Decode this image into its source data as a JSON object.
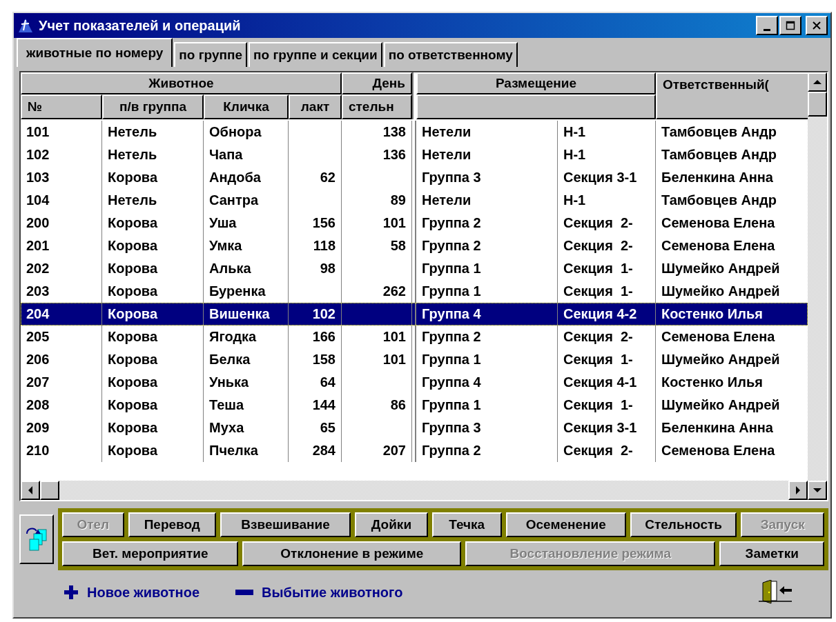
{
  "window": {
    "title": "Учет показателей и операций"
  },
  "tabs": [
    {
      "label": "животные по номеру",
      "selected": true
    },
    {
      "label": "по группе",
      "selected": false
    },
    {
      "label": "по группе и секции",
      "selected": false
    },
    {
      "label": "по ответственному",
      "selected": false
    }
  ],
  "table": {
    "group_headers": {
      "animal": "Животное",
      "day": "День",
      "placement": "Размещение",
      "responsible": "Ответственный("
    },
    "columns": [
      "№",
      "п/в группа",
      "Кличка",
      "лакт",
      "стельн"
    ],
    "rows": [
      {
        "number": "101",
        "group": "Нетель",
        "name": "Обнора",
        "days": "138",
        "placement": "Нетели",
        "section": "Н-1",
        "responsible": "Тамбовцев Андр",
        "selected": false
      },
      {
        "number": "102",
        "group": "Нетель",
        "name": "Чапа",
        "days": "136",
        "placement": "Нетели",
        "section": "Н-1",
        "responsible": "Тамбовцев Андр",
        "selected": false
      },
      {
        "number": "103",
        "group": "Корова",
        "name": "Андоба",
        "lact": "62",
        "placement": "Группа 3",
        "section": "Секция 3-1",
        "responsible": "Беленкина Анна",
        "selected": false
      },
      {
        "number": "104",
        "group": "Нетель",
        "name": "Сантра",
        "days": "89",
        "placement": "Нетели",
        "section": "Н-1",
        "responsible": "Тамбовцев Андр",
        "selected": false
      },
      {
        "number": "200",
        "group": "Корова",
        "name": "Уша",
        "lact": "156",
        "days": "101",
        "placement": "Группа 2",
        "section": "Секция  2-",
        "responsible": "Семенова Елена",
        "selected": false
      },
      {
        "number": "201",
        "group": "Корова",
        "name": "Умка",
        "lact": "118",
        "days": "58",
        "placement": "Группа 2",
        "section": "Секция  2-",
        "responsible": "Семенова Елена",
        "selected": false
      },
      {
        "number": "202",
        "group": "Корова",
        "name": "Алька",
        "lact": "98",
        "placement": "Группа 1",
        "section": "Секция  1-",
        "responsible": "Шумейко Андрей",
        "selected": false
      },
      {
        "number": "203",
        "group": "Корова",
        "name": "Буренка",
        "days": "262",
        "placement": "Группа 1",
        "section": "Секция  1-",
        "responsible": "Шумейко Андрей",
        "selected": false
      },
      {
        "number": "204",
        "group": "Корова",
        "name": "Вишенка",
        "lact": "102",
        "placement": "Группа 4",
        "section": "Секция 4-2",
        "responsible": "Костенко Илья",
        "selected": true
      },
      {
        "number": "205",
        "group": "Корова",
        "name": "Ягодка",
        "lact": "166",
        "days": "101",
        "placement": "Группа 2",
        "section": "Секция  2-",
        "responsible": "Семенова Елена",
        "selected": false
      },
      {
        "number": "206",
        "group": "Корова",
        "name": "Белка",
        "lact": "158",
        "days": "101",
        "placement": "Группа 1",
        "section": "Секция  1-",
        "responsible": "Шумейко Андрей",
        "selected": false
      },
      {
        "number": "207",
        "group": "Корова",
        "name": "Унька",
        "lact": "64",
        "placement": "Группа 4",
        "section": "Секция 4-1",
        "responsible": "Костенко Илья",
        "selected": false
      },
      {
        "number": "208",
        "group": "Корова",
        "name": "Теша",
        "lact": "144",
        "days": "86",
        "placement": "Группа 1",
        "section": "Секция  1-",
        "responsible": "Шумейко Андрей",
        "selected": false
      },
      {
        "number": "209",
        "group": "Корова",
        "name": "Муха",
        "lact": "65",
        "placement": "Группа 3",
        "section": "Секция 3-1",
        "responsible": "Беленкина Анна",
        "selected": false
      },
      {
        "number": "210",
        "group": "Корова",
        "name": "Пчелка",
        "lact": "284",
        "days": "207",
        "placement": "Группа 2",
        "section": "Секция  2-",
        "responsible": "Семенова Елена",
        "selected": false
      }
    ]
  },
  "action_rows": [
    [
      {
        "label": "Отел",
        "disabled": true
      },
      {
        "label": "Перевод",
        "disabled": false
      },
      {
        "label": "Взвешивание",
        "disabled": false
      },
      {
        "label": "Дойки",
        "disabled": false
      },
      {
        "label": "Течка",
        "disabled": false
      },
      {
        "label": "Осеменение",
        "disabled": false
      },
      {
        "label": "Стельность",
        "disabled": false
      },
      {
        "label": "Запуск",
        "disabled": true
      }
    ],
    [
      {
        "label": "Вет. мероприятие",
        "disabled": false
      },
      {
        "label": "Отклонение в режиме",
        "disabled": false
      },
      {
        "label": "Восстановление режима",
        "disabled": true
      },
      {
        "label": "Заметки",
        "disabled": false
      }
    ]
  ],
  "footer": {
    "add_link": "Новое животное",
    "remove_link": "Выбытие животного"
  }
}
